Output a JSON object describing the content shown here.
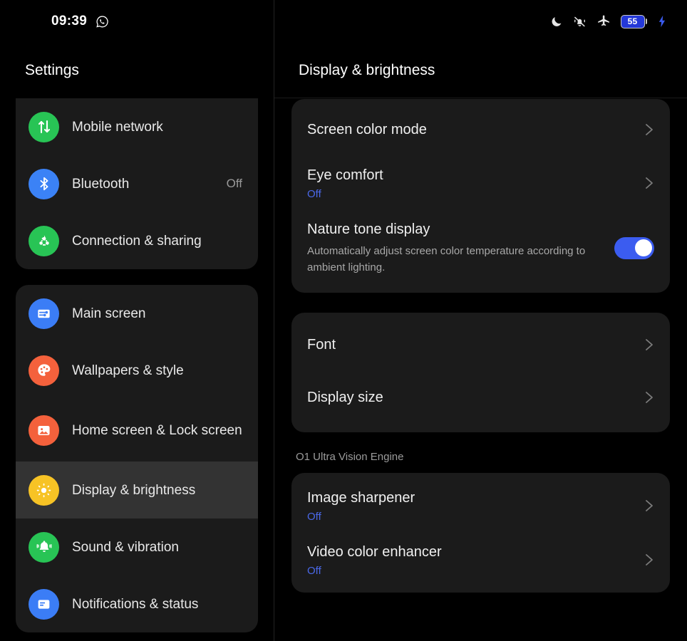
{
  "status_bar": {
    "time": "09:39",
    "left_icons": [
      "whatsapp-icon"
    ],
    "right_icons": [
      "moon-icon",
      "bell-muted-icon",
      "airplane-icon",
      "charging-bolt-icon"
    ],
    "battery_level": "55",
    "battery_color": "#2438d8"
  },
  "left_pane": {
    "title": "Settings",
    "groups": [
      {
        "partial_top_item": {
          "label": "",
          "icon": "wifi-icon",
          "icon_color": "#2f7af0"
        },
        "items": [
          {
            "label": "Mobile network",
            "icon": "mobile-network-icon",
            "icon_color": "#28c455",
            "value": ""
          },
          {
            "label": "Bluetooth",
            "icon": "bluetooth-icon",
            "icon_color": "#3b82f6",
            "value": "Off"
          },
          {
            "label": "Connection & sharing",
            "icon": "connection-sharing-icon",
            "icon_color": "#28c455",
            "value": ""
          }
        ]
      },
      {
        "items": [
          {
            "label": "Main screen",
            "icon": "main-screen-icon",
            "icon_color": "#3b7df6",
            "value": "",
            "selected": false
          },
          {
            "label": "Wallpapers & style",
            "icon": "palette-icon",
            "icon_color": "#f4613c",
            "value": "",
            "selected": false
          },
          {
            "label": "Home screen & Lock screen",
            "icon": "photo-icon",
            "icon_color": "#f4613c",
            "value": "",
            "selected": false
          },
          {
            "label": "Display & brightness",
            "icon": "brightness-sun-icon",
            "icon_color": "#f7c325",
            "value": "",
            "selected": true
          },
          {
            "label": "Sound & vibration",
            "icon": "bell-icon",
            "icon_color": "#28c455",
            "value": "",
            "selected": false
          },
          {
            "label": "Notifications & status",
            "icon": "notifications-icon",
            "icon_color": "#3b7df6",
            "value": "",
            "selected": false
          }
        ]
      }
    ]
  },
  "right_pane": {
    "title": "Display & brightness",
    "card1": [
      {
        "title": "Screen color mode",
        "sub": "",
        "desc": "",
        "control": "chevron"
      },
      {
        "title": "Eye comfort",
        "sub": "Off",
        "desc": "",
        "control": "chevron"
      },
      {
        "title": "Nature tone display",
        "sub": "",
        "desc": "Automatically adjust screen color temperature according to ambient lighting.",
        "control": "toggle",
        "toggle_on": true
      }
    ],
    "card2": [
      {
        "title": "Font",
        "sub": "",
        "desc": "",
        "control": "chevron"
      },
      {
        "title": "Display size",
        "sub": "",
        "desc": "",
        "control": "chevron"
      }
    ],
    "section_header": "O1 Ultra Vision Engine",
    "card3": [
      {
        "title": "Image sharpener",
        "sub": "Off",
        "desc": "",
        "control": "chevron"
      },
      {
        "title": "Video color enhancer",
        "sub": "Off",
        "desc": "",
        "control": "chevron"
      }
    ]
  },
  "colors": {
    "accent_blue": "#4a68e8",
    "toggle_on": "#3b5cf0",
    "card_bg": "#1b1b1b",
    "selected_row": "#333333"
  }
}
